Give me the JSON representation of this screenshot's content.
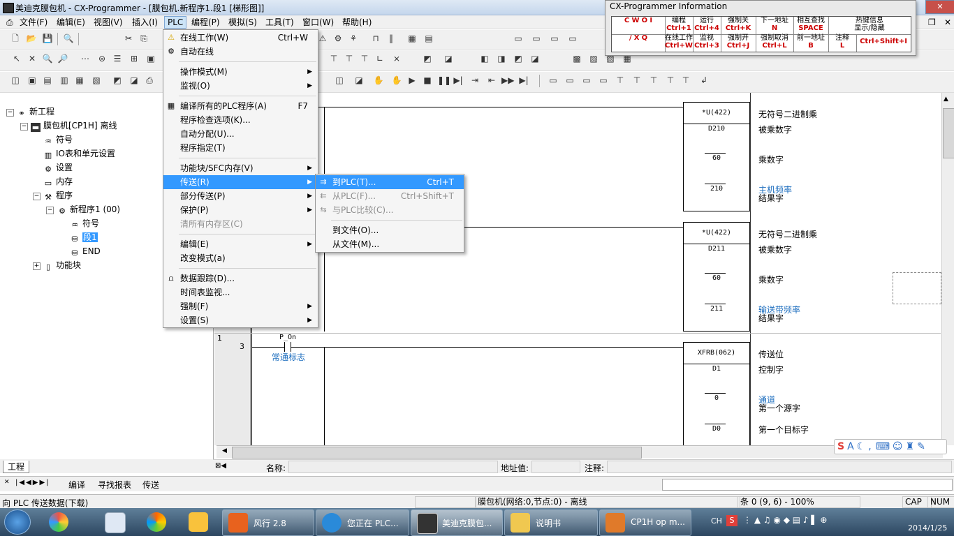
{
  "window": {
    "title": "美迪克膜包机 - CX-Programmer - [膜包机.新程序1.段1 [梯形图]]"
  },
  "menubar": [
    "文件(F)",
    "编辑(E)",
    "视图(V)",
    "插入(I)",
    "PLC",
    "编程(P)",
    "模拟(S)",
    "工具(T)",
    "窗口(W)",
    "帮助(H)"
  ],
  "tree": {
    "project": "新工程",
    "plc": "膜包机[CP1H] 离线",
    "items": [
      "符号",
      "IO表和单元设置",
      "设置",
      "内存",
      "程序"
    ],
    "program": "新程序1 (00)",
    "program_items": [
      "符号",
      "段1",
      "END"
    ],
    "function_blocks": "功能块"
  },
  "plc_menu": [
    {
      "label": "在线工作(W)",
      "shortcut": "Ctrl+W",
      "icon": "warning-icon"
    },
    {
      "label": "自动在线",
      "icon": "auto-online-icon"
    },
    {
      "label": "操作模式(M)",
      "submenu": true
    },
    {
      "label": "监视(O)",
      "submenu": true
    },
    {
      "label": "编译所有的PLC程序(A)",
      "shortcut": "F7",
      "icon": "compile-icon"
    },
    {
      "label": "程序检查选项(K)..."
    },
    {
      "label": "自动分配(U)..."
    },
    {
      "label": "程序指定(T)"
    },
    {
      "label": "功能块/SFC内存(V)",
      "submenu": true
    },
    {
      "label": "传送(R)",
      "submenu": true,
      "highlighted": true
    },
    {
      "label": "部分传送(P)",
      "submenu": true
    },
    {
      "label": "保护(P)",
      "submenu": true
    },
    {
      "label": "清所有内存区(C)",
      "disabled": true
    },
    {
      "label": "编辑(E)",
      "submenu": true
    },
    {
      "label": "改变模式(a)"
    },
    {
      "label": "数据跟踪(D)...",
      "icon": "trace-icon"
    },
    {
      "label": "时间表监视..."
    },
    {
      "label": "强制(F)",
      "submenu": true
    },
    {
      "label": "设置(S)",
      "submenu": true
    }
  ],
  "transfer_menu": [
    {
      "label": "到PLC(T)...",
      "shortcut": "Ctrl+T",
      "highlighted": true
    },
    {
      "label": "从PLC(F)...",
      "shortcut": "Ctrl+Shift+T",
      "disabled": true
    },
    {
      "label": "与PLC比较(C)...",
      "disabled": true
    },
    {
      "label": "到文件(O)..."
    },
    {
      "label": "从文件(M)..."
    }
  ],
  "info": {
    "title": "CX-Programmer Information",
    "row1": [
      [
        "C",
        "W",
        "O",
        "I"
      ],
      [
        "编程",
        "Ctrl+1"
      ],
      [
        "运行",
        "Ctrl+4"
      ],
      [
        "强制关",
        "Ctrl+K"
      ],
      [
        "下一地址",
        "N"
      ],
      [
        "相互查找",
        "SPACE"
      ],
      [
        "热键信息",
        "显示/隐藏"
      ]
    ],
    "row2": [
      [
        "/",
        "X",
        "Q"
      ],
      [
        "在线工作",
        "Ctrl+W"
      ],
      [
        "监视",
        "Ctrl+3"
      ],
      [
        "强制开",
        "Ctrl+J"
      ],
      [
        "强制取消",
        "Ctrl+L"
      ],
      [
        "前一地址",
        "B"
      ],
      [
        "注释",
        "L"
      ],
      [
        "Ctrl+Shift+I"
      ]
    ]
  },
  "ladder": {
    "block1": {
      "instr": "*U(422)",
      "ops": [
        "D210",
        "60",
        "210"
      ],
      "comments": [
        "无符号二进制乘",
        "被乘数字",
        "乘数字",
        "主机频率",
        "结果字"
      ]
    },
    "block2": {
      "instr": "*U(422)",
      "ops": [
        "D211",
        "60",
        "211"
      ],
      "comments": [
        "无符号二进制乘",
        "被乘数字",
        "乘数字",
        "输送带频率",
        "结果字"
      ]
    },
    "rung3": {
      "rung_no": "1",
      "step": "3",
      "contact": "P_On",
      "contact_comment": "常通标志",
      "instr": "XFRB(062)",
      "ops": [
        "D1",
        "0",
        "D0"
      ],
      "comments": [
        "传送位",
        "控制字",
        "通道",
        "第一个源字",
        "第一个目标字"
      ]
    }
  },
  "bottom": {
    "tab_project": "工程",
    "name_label": "名称:",
    "addr_label": "地址值:",
    "comment_label": "注释:",
    "output_tabs": [
      "编译",
      "寻找报表",
      "传送"
    ]
  },
  "status": {
    "left": "向 PLC 传送数据(下载)",
    "mid": "膜包机(网络:0,节点:0) - 离线",
    "pos": "条 0 (9, 6)  - 100%",
    "caps": "CAP",
    "num": "NUM"
  },
  "taskbar": {
    "apps": [
      "风行 2.8",
      "您正在 PLC...",
      "美迪克膜包...",
      "说明书",
      "CP1H op m..."
    ],
    "lang": "CH",
    "date": "2014/1/25"
  },
  "colors": {
    "highlight": "#3399ff",
    "comment_blue": "#1f6fbf",
    "hotkey_red": "#cc0000"
  }
}
